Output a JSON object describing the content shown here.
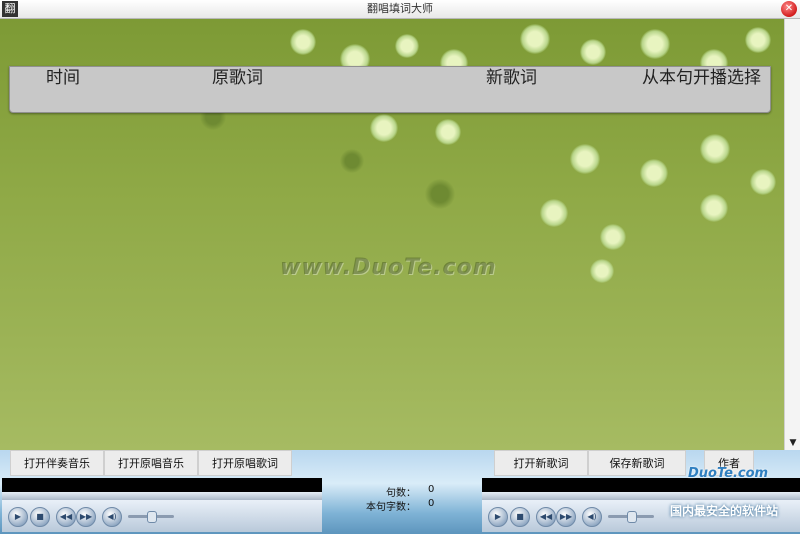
{
  "window": {
    "title": "翻唱填词大师",
    "close_glyph": "✕",
    "app_icon_glyph": "翻"
  },
  "lyric_table": {
    "columns": [
      "时间",
      "原歌词",
      "新歌词",
      "从本句开播选择"
    ]
  },
  "watermark": "www.DuoTe.com",
  "scrollbar": {
    "down_glyph": "▼"
  },
  "buttons": {
    "open_accompaniment": "打开伴奏音乐",
    "open_original_music": "打开原唱音乐",
    "open_original_lyrics": "打开原唱歌词",
    "open_new_lyrics": "打开新歌词",
    "save_new_lyrics": "保存新歌词",
    "author": "作者"
  },
  "stats": {
    "sentence_count_label": "句数：",
    "sentence_count_value": "0",
    "sentence_chars_label": "本句字数：",
    "sentence_chars_value": "0"
  },
  "players": {
    "play_glyph": "▶",
    "stop_glyph": "■",
    "prev_glyph": "◀◀",
    "next_glyph": "▶▶",
    "mute_glyph": "◀)",
    "left_volume": 0.5,
    "right_volume": 0.5
  },
  "branding": {
    "site": "DuoTe.com",
    "tagline": "国内最安全的软件站"
  },
  "colors": {
    "background_green": "#8fa946",
    "player_blue": "#b9d7ef"
  }
}
